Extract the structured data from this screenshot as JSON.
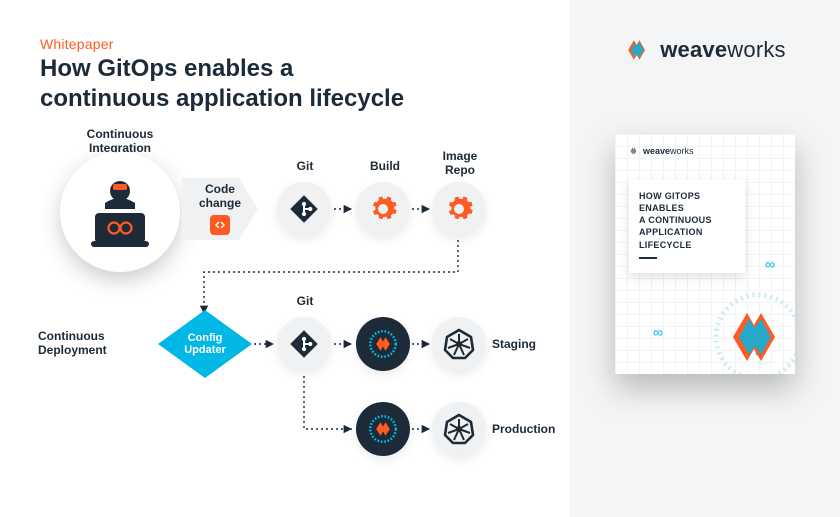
{
  "header": {
    "eyebrow": "Whitepaper",
    "title_line1": "How GitOps enables a",
    "title_line2": "continuous application lifecycle"
  },
  "brand": {
    "strong": "weave",
    "light": "works"
  },
  "diagram": {
    "ci_label": "Continuous\nIntegration",
    "cd_label": "Continuous\nDeployment",
    "code_change": "Code\nchange",
    "git": "Git",
    "build": "Build",
    "image_repo": "Image\nRepo",
    "config_updater": "Config\nUpdater",
    "staging": "Staging",
    "production": "Production"
  },
  "paper": {
    "title": "HOW GITOPS\nENABLES\nA CONTINUOUS\nAPPLICATION\nLIFECYCLE"
  }
}
